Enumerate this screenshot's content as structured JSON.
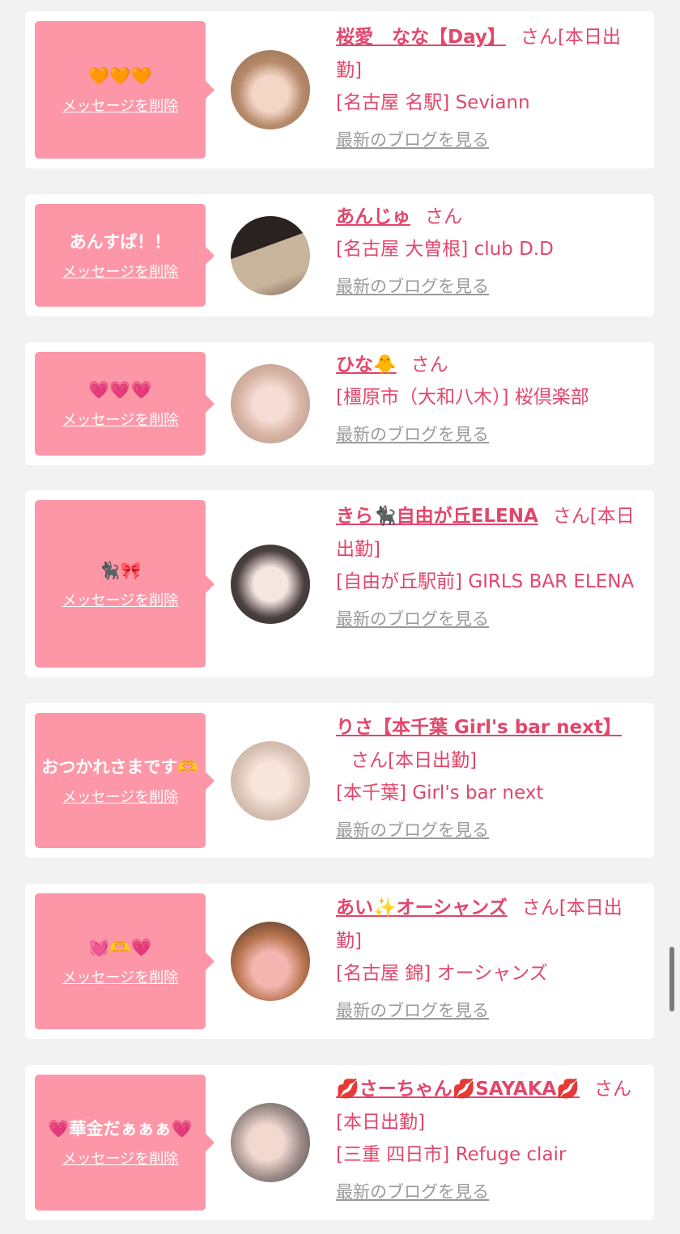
{
  "delete_label": "メッセージを削除",
  "blog_label": "最新のブログを見る",
  "san_label": "さん",
  "colors": {
    "bubble": "#fd97a8",
    "accent": "#e2466b",
    "link_gray": "#9a9a9a",
    "background": "#f2f2f2"
  },
  "items": [
    {
      "message": "🧡🧡🧡",
      "name": "桜愛　なな【Day】",
      "suffix": "[本日出勤]",
      "shop": "[名古屋 名駅] Seviann",
      "avatar": "avatar-photo"
    },
    {
      "message": "あんすぱ！！",
      "name": "あんじゅ",
      "suffix": "",
      "shop": "[名古屋 大曽根] club D.D",
      "avatar": "avatar-photo"
    },
    {
      "message": "💗💗💗",
      "name": "ひな🐥",
      "suffix": "",
      "shop": "[橿原市（大和八木）] 桜倶楽部",
      "avatar": "avatar-photo"
    },
    {
      "message": "🐈‍⬛🎀",
      "name": "きら🐈‍⬛自由が丘ELENA",
      "suffix": "[本日出勤]",
      "shop": "[自由が丘駅前] GIRLS BAR ELENA",
      "avatar": "avatar-photo"
    },
    {
      "message": "おつかれさまです🫶",
      "name": "りさ【本千葉 Girl's bar next】",
      "suffix": "[本日出勤]",
      "shop": "[本千葉] Girl's bar next",
      "avatar": "avatar-photo"
    },
    {
      "message": "💓🫶💗",
      "name": "あい✨オーシャンズ",
      "suffix": "[本日出勤]",
      "shop": "[名古屋 錦] オーシャンズ",
      "avatar": "avatar-photo"
    },
    {
      "message": "💗華金だぁぁぁ💗",
      "name": "💋さーちゃん💋SAYAKA💋",
      "suffix": "[本日出勤]",
      "shop": "[三重 四日市] Refuge clair",
      "avatar": "avatar-photo"
    }
  ]
}
